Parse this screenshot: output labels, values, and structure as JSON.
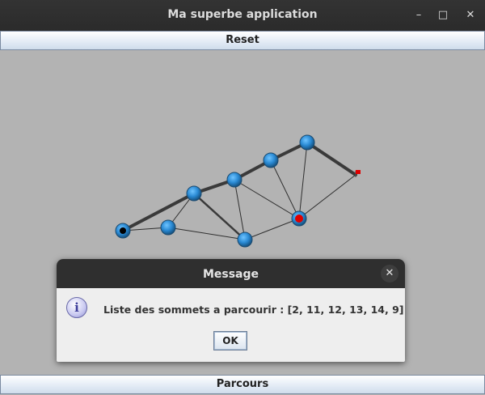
{
  "window": {
    "title": "Ma superbe application",
    "controls": {
      "minimize": "–",
      "maximize": "□",
      "close": "✕"
    }
  },
  "toolbar": {
    "reset_label": "Reset",
    "parcours_label": "Parcours"
  },
  "dialog": {
    "title": "Message",
    "close_glyph": "✕",
    "icon_glyph": "i",
    "message": "Liste des sommets a parcourir : [2, 11, 12, 13, 14, 9]",
    "ok_label": "OK"
  },
  "colors": {
    "canvas": "#b3b3b3",
    "node": "#2a8ad4",
    "start_marker": "#000000",
    "selected_marker": "#e00000",
    "flag": "#e00000"
  }
}
